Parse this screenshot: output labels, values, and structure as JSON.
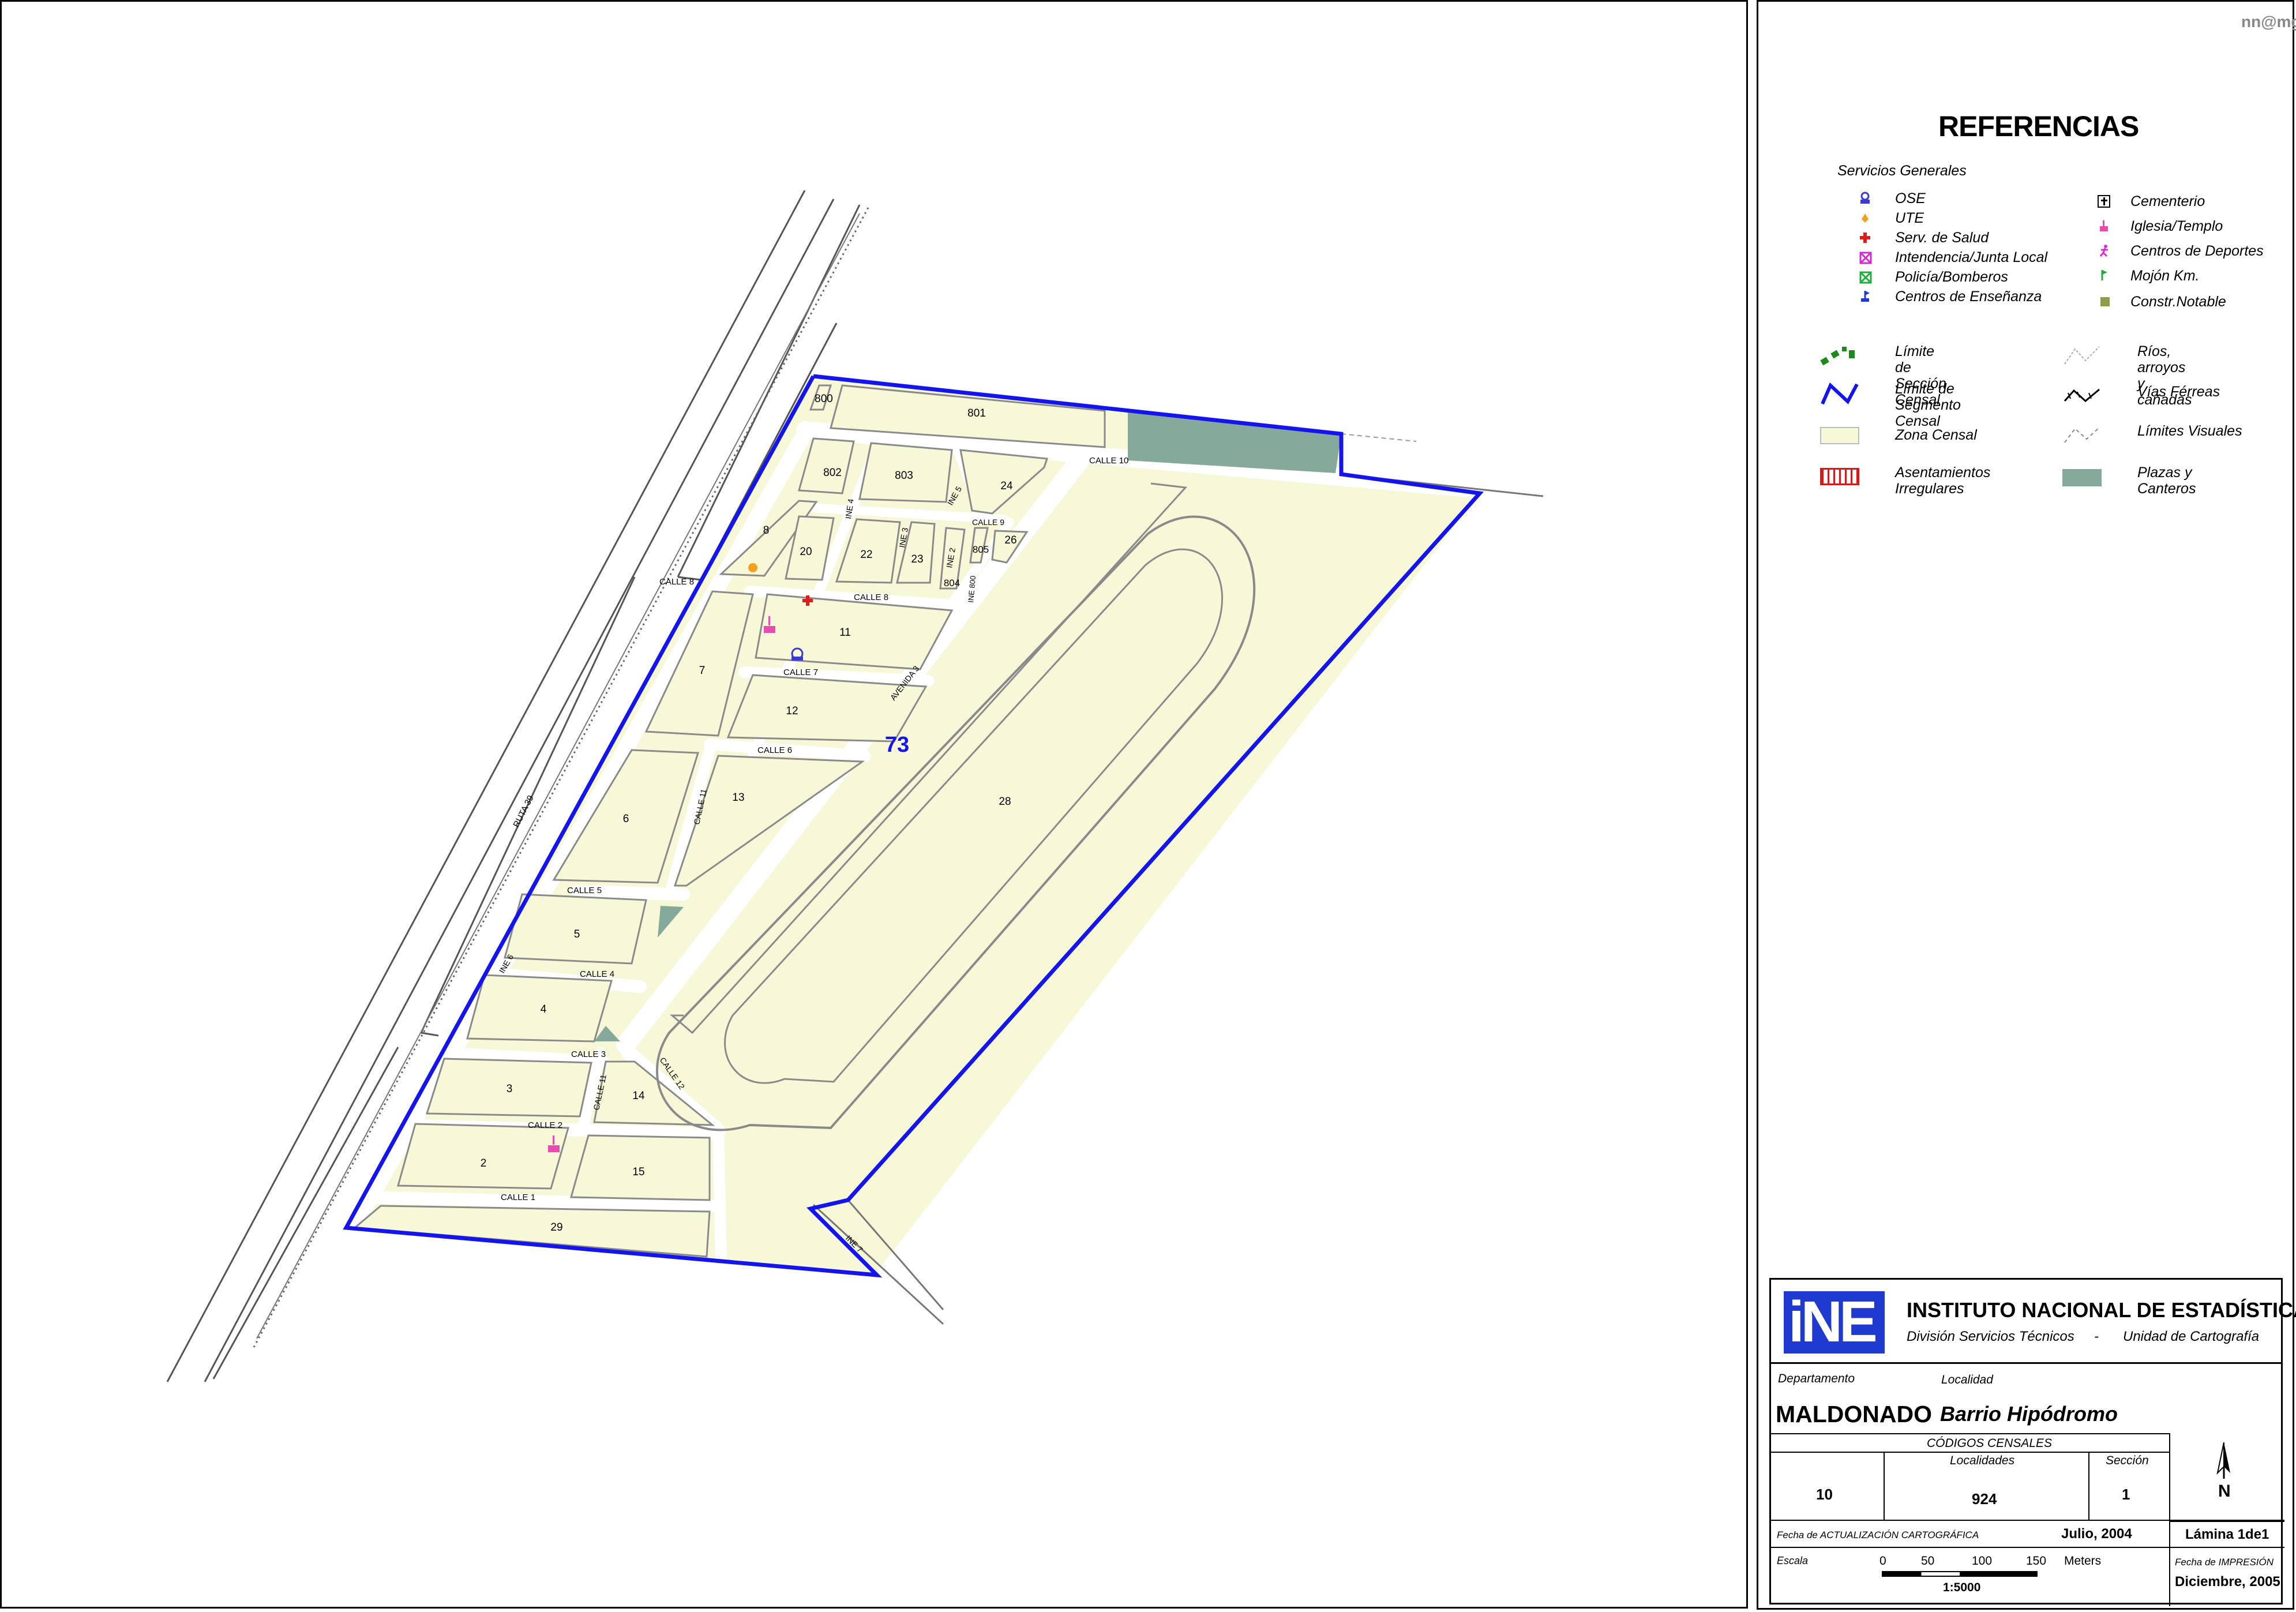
{
  "watermark": "nn@mg",
  "legend": {
    "title": "REFERENCIAS",
    "subtitle": "Servicios Generales",
    "services_left": [
      {
        "label": "OSE",
        "icon": "ose-icon",
        "color": "#3a3ad0"
      },
      {
        "label": "UTE",
        "icon": "ute-icon",
        "color": "#f2a21b"
      },
      {
        "label": "Serv. de Salud",
        "icon": "health-cross-icon",
        "color": "#e01b1b"
      },
      {
        "label": "Intendencia/Junta Local",
        "icon": "intendencia-icon",
        "color": "#d02ad0"
      },
      {
        "label": "Policía/Bomberos",
        "icon": "police-icon",
        "color": "#1fae3a"
      },
      {
        "label": "Centros de Enseñanza",
        "icon": "school-flag-icon",
        "color": "#1f3ad0"
      }
    ],
    "services_right": [
      {
        "label": "Cementerio",
        "icon": "cemetery-cross-icon",
        "color": "#000000"
      },
      {
        "label": "Iglesia/Templo",
        "icon": "church-icon",
        "color": "#e84cae"
      },
      {
        "label": "Centros de Deportes",
        "icon": "sports-runner-icon",
        "color": "#e02ad8"
      },
      {
        "label": "Mojón Km.",
        "icon": "km-marker-flag-icon",
        "color": "#1fae3a"
      },
      {
        "label": "Constr.Notable",
        "icon": "notable-building-square-icon",
        "color": "#8c9e4a"
      }
    ],
    "lines_left": [
      {
        "label": "Límite de\nSección Censal",
        "icon": "section-limit-icon"
      },
      {
        "label": "Límite de\nSegmento Censal",
        "icon": "segment-limit-icon"
      },
      {
        "label": "Zona Censal",
        "icon": "census-zone-swatch-icon"
      },
      {
        "label": "Asentamientos\nIrregulares",
        "icon": "irregular-settlement-swatch-icon"
      }
    ],
    "lines_right": [
      {
        "label": "Ríos, arroyos\ny cañadas",
        "icon": "rivers-line-icon"
      },
      {
        "label": "Vías Férreas",
        "icon": "railway-line-icon"
      },
      {
        "label": "Límites  Visuales",
        "icon": "visual-limit-line-icon"
      },
      {
        "label": "Plazas y\nCanteros",
        "icon": "plazas-swatch-icon"
      }
    ],
    "colors": {
      "zona_censal": "#f7f8d7",
      "plazas": "#85aa9c",
      "segment_limit": "#1414ee",
      "section_limit": "#1a8a1a",
      "irregular": "#d81818"
    }
  },
  "title_block": {
    "logo_text": "iNE",
    "institute": "INSTITUTO NACIONAL DE ESTADÍSTICA",
    "division": "División Servicios Técnicos",
    "separator": "-",
    "unit": "Unidad de Cartografía",
    "departamento_label": "Departamento",
    "localidad_label": "Localidad",
    "departamento": "MALDONADO",
    "localidad": "Barrio Hipódromo",
    "codigos_label": "CÓDIGOS CENSALES",
    "localidades_label": "Localidades",
    "seccion_label": "Sección",
    "code_dept": "10",
    "code_localidad": "924",
    "code_seccion": "1",
    "lamina": "Lámina 1de1",
    "fecha_act_label": "Fecha de ACTUALIZACIÓN CARTOGRÁFICA",
    "fecha_act": "Julio, 2004",
    "fecha_imp_label": "Fecha de IMPRESIÓN",
    "fecha_imp": "Diciembre, 2005",
    "escala_label": "Escala",
    "scale_ticks": [
      "0",
      "50",
      "100",
      "150"
    ],
    "scale_unit": "Meters",
    "scale_ratio": "1:5000",
    "north": "N"
  },
  "map": {
    "segment_label": "73",
    "blocks": [
      "800",
      "801",
      "802",
      "803",
      "24",
      "8",
      "20",
      "22",
      "23",
      "805",
      "26",
      "804",
      "11",
      "7",
      "12",
      "13",
      "6",
      "28",
      "5",
      "4",
      "3",
      "14",
      "2",
      "15",
      "29"
    ],
    "streets": [
      "RUTA 39",
      "CALLE 8",
      "CALLE 10",
      "INE 4",
      "INE 5",
      "INE 3",
      "INE 2",
      "CALLE 9",
      "CALLE 8",
      "INE 800",
      "CALLE 7",
      "AVENIDA 3",
      "CALLE 6",
      "CALLE 11",
      "CALLE 5",
      "CALLE 4",
      "INE 6",
      "CALLE 3",
      "CALLE 11",
      "CALLE 12",
      "CALLE 2",
      "CALLE 1",
      "INE 7"
    ]
  }
}
